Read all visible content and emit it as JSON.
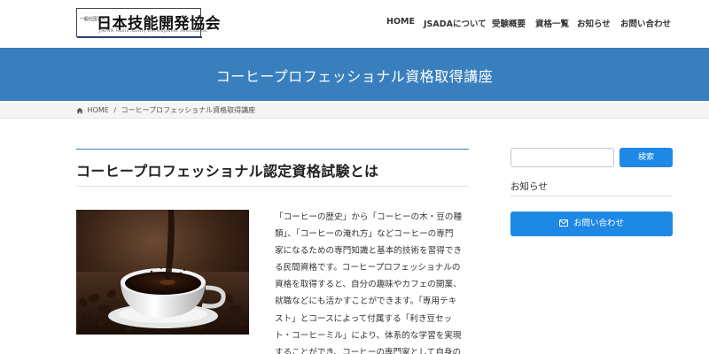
{
  "header": {
    "logo": {
      "small_text": "一般社団法人",
      "main_text": "日本技能開発協会",
      "sub_text": "JAPAN Skills Ability Development Association"
    },
    "nav": [
      {
        "label": "HOME"
      },
      {
        "label": "JSADAについて"
      },
      {
        "label": "受験概要"
      },
      {
        "label": "資格一覧"
      },
      {
        "label": "お知らせ"
      },
      {
        "label": "お問い合わせ"
      }
    ]
  },
  "banner": {
    "title": "コーヒープロフェッショナル資格取得講座"
  },
  "breadcrumb": {
    "home": "HOME",
    "separator": "/",
    "current": "コーヒープロフェッショナル資格取得講座"
  },
  "main": {
    "heading": "コーヒープロフェッショナル認定資格試験とは",
    "paragraph_lines": [
      "「コーヒーの歴史」から「コーヒーの木・豆の種",
      "類」、「コーヒーの淹れ方」などコーヒーの専門",
      "家になるための専門知識と基本的技術を習得でき",
      "る民間資格です。コーヒープロフェッショナルの",
      "資格を取得すると、自分の趣味やカフェの開業、",
      "就職などにも活かすことができます。「専用テキ",
      "スト」とコースによって付属する「利き豆セッ",
      "ト・コーヒーミル」により、体系的な学習を実現",
      "することができ、コーヒーの専門家として自身の"
    ]
  },
  "sidebar": {
    "search": {
      "value": "",
      "placeholder": "",
      "button_label": "検索"
    },
    "news_title": "お知らせ",
    "contact_label": "お問い合わせ"
  },
  "colors": {
    "banner": "#3a7fbd",
    "accent_button": "#1e88e5",
    "logo_bar": "#2f3a7a"
  }
}
